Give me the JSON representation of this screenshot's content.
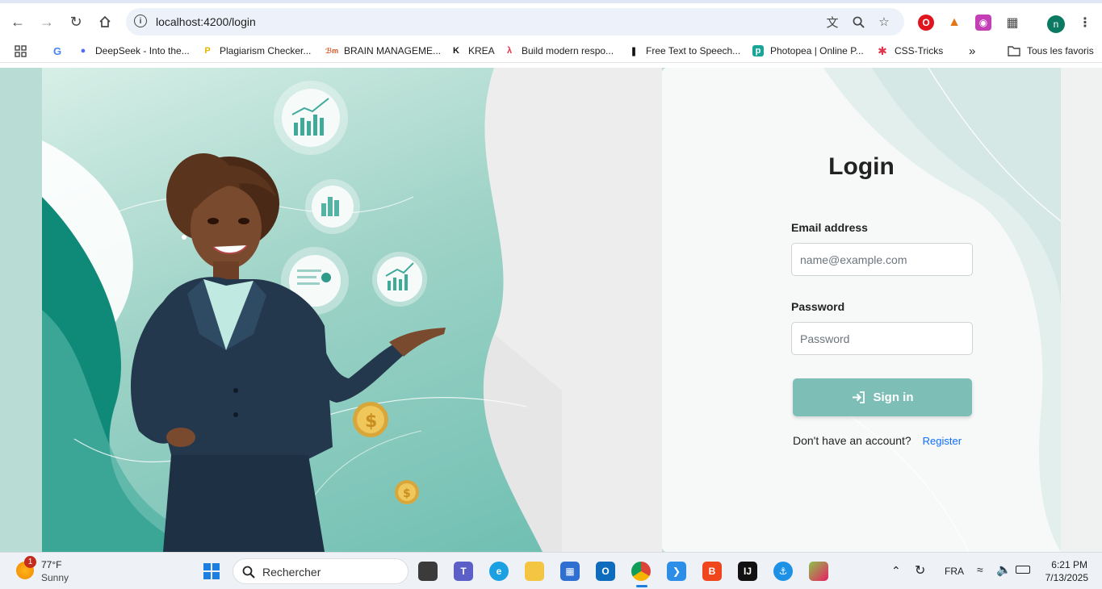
{
  "browser": {
    "url": "localhost:4200/login",
    "bookmarks": [
      {
        "label": "",
        "icon": "google-icon"
      },
      {
        "label": "DeepSeek - Into the...",
        "icon": "deepseek-icon"
      },
      {
        "label": "Plagiarism Checker...",
        "icon": "plagiarism-icon"
      },
      {
        "label": "BRAIN MANAGEME...",
        "icon": "brain-icon"
      },
      {
        "label": "KREA",
        "icon": "krea-icon"
      },
      {
        "label": "Build modern respo...",
        "icon": "build-icon"
      },
      {
        "label": "Free Text to Speech...",
        "icon": "tts-icon"
      },
      {
        "label": "Photopea | Online P...",
        "icon": "photopea-icon"
      },
      {
        "label": "CSS-Tricks",
        "icon": "css-tricks-icon"
      }
    ],
    "all_bookmarks_label": "Tous les favoris",
    "profile_initial": "n"
  },
  "login": {
    "title": "Login",
    "email_label": "Email address",
    "email_placeholder": "name@example.com",
    "password_label": "Password",
    "password_placeholder": "Password",
    "signin_label": "Sign in",
    "no_account_text": "Don't have an account?",
    "register_label": "Register"
  },
  "taskbar": {
    "weather_temp": "77°F",
    "weather_desc": "Sunny",
    "weather_badge": "1",
    "search_placeholder": "Rechercher",
    "language": "FRA",
    "time": "6:21 PM",
    "date": "7/13/2025"
  },
  "colors": {
    "accent": "#7dbfb6",
    "link": "#0d6efd",
    "hero_teal": "#0f8a79"
  }
}
